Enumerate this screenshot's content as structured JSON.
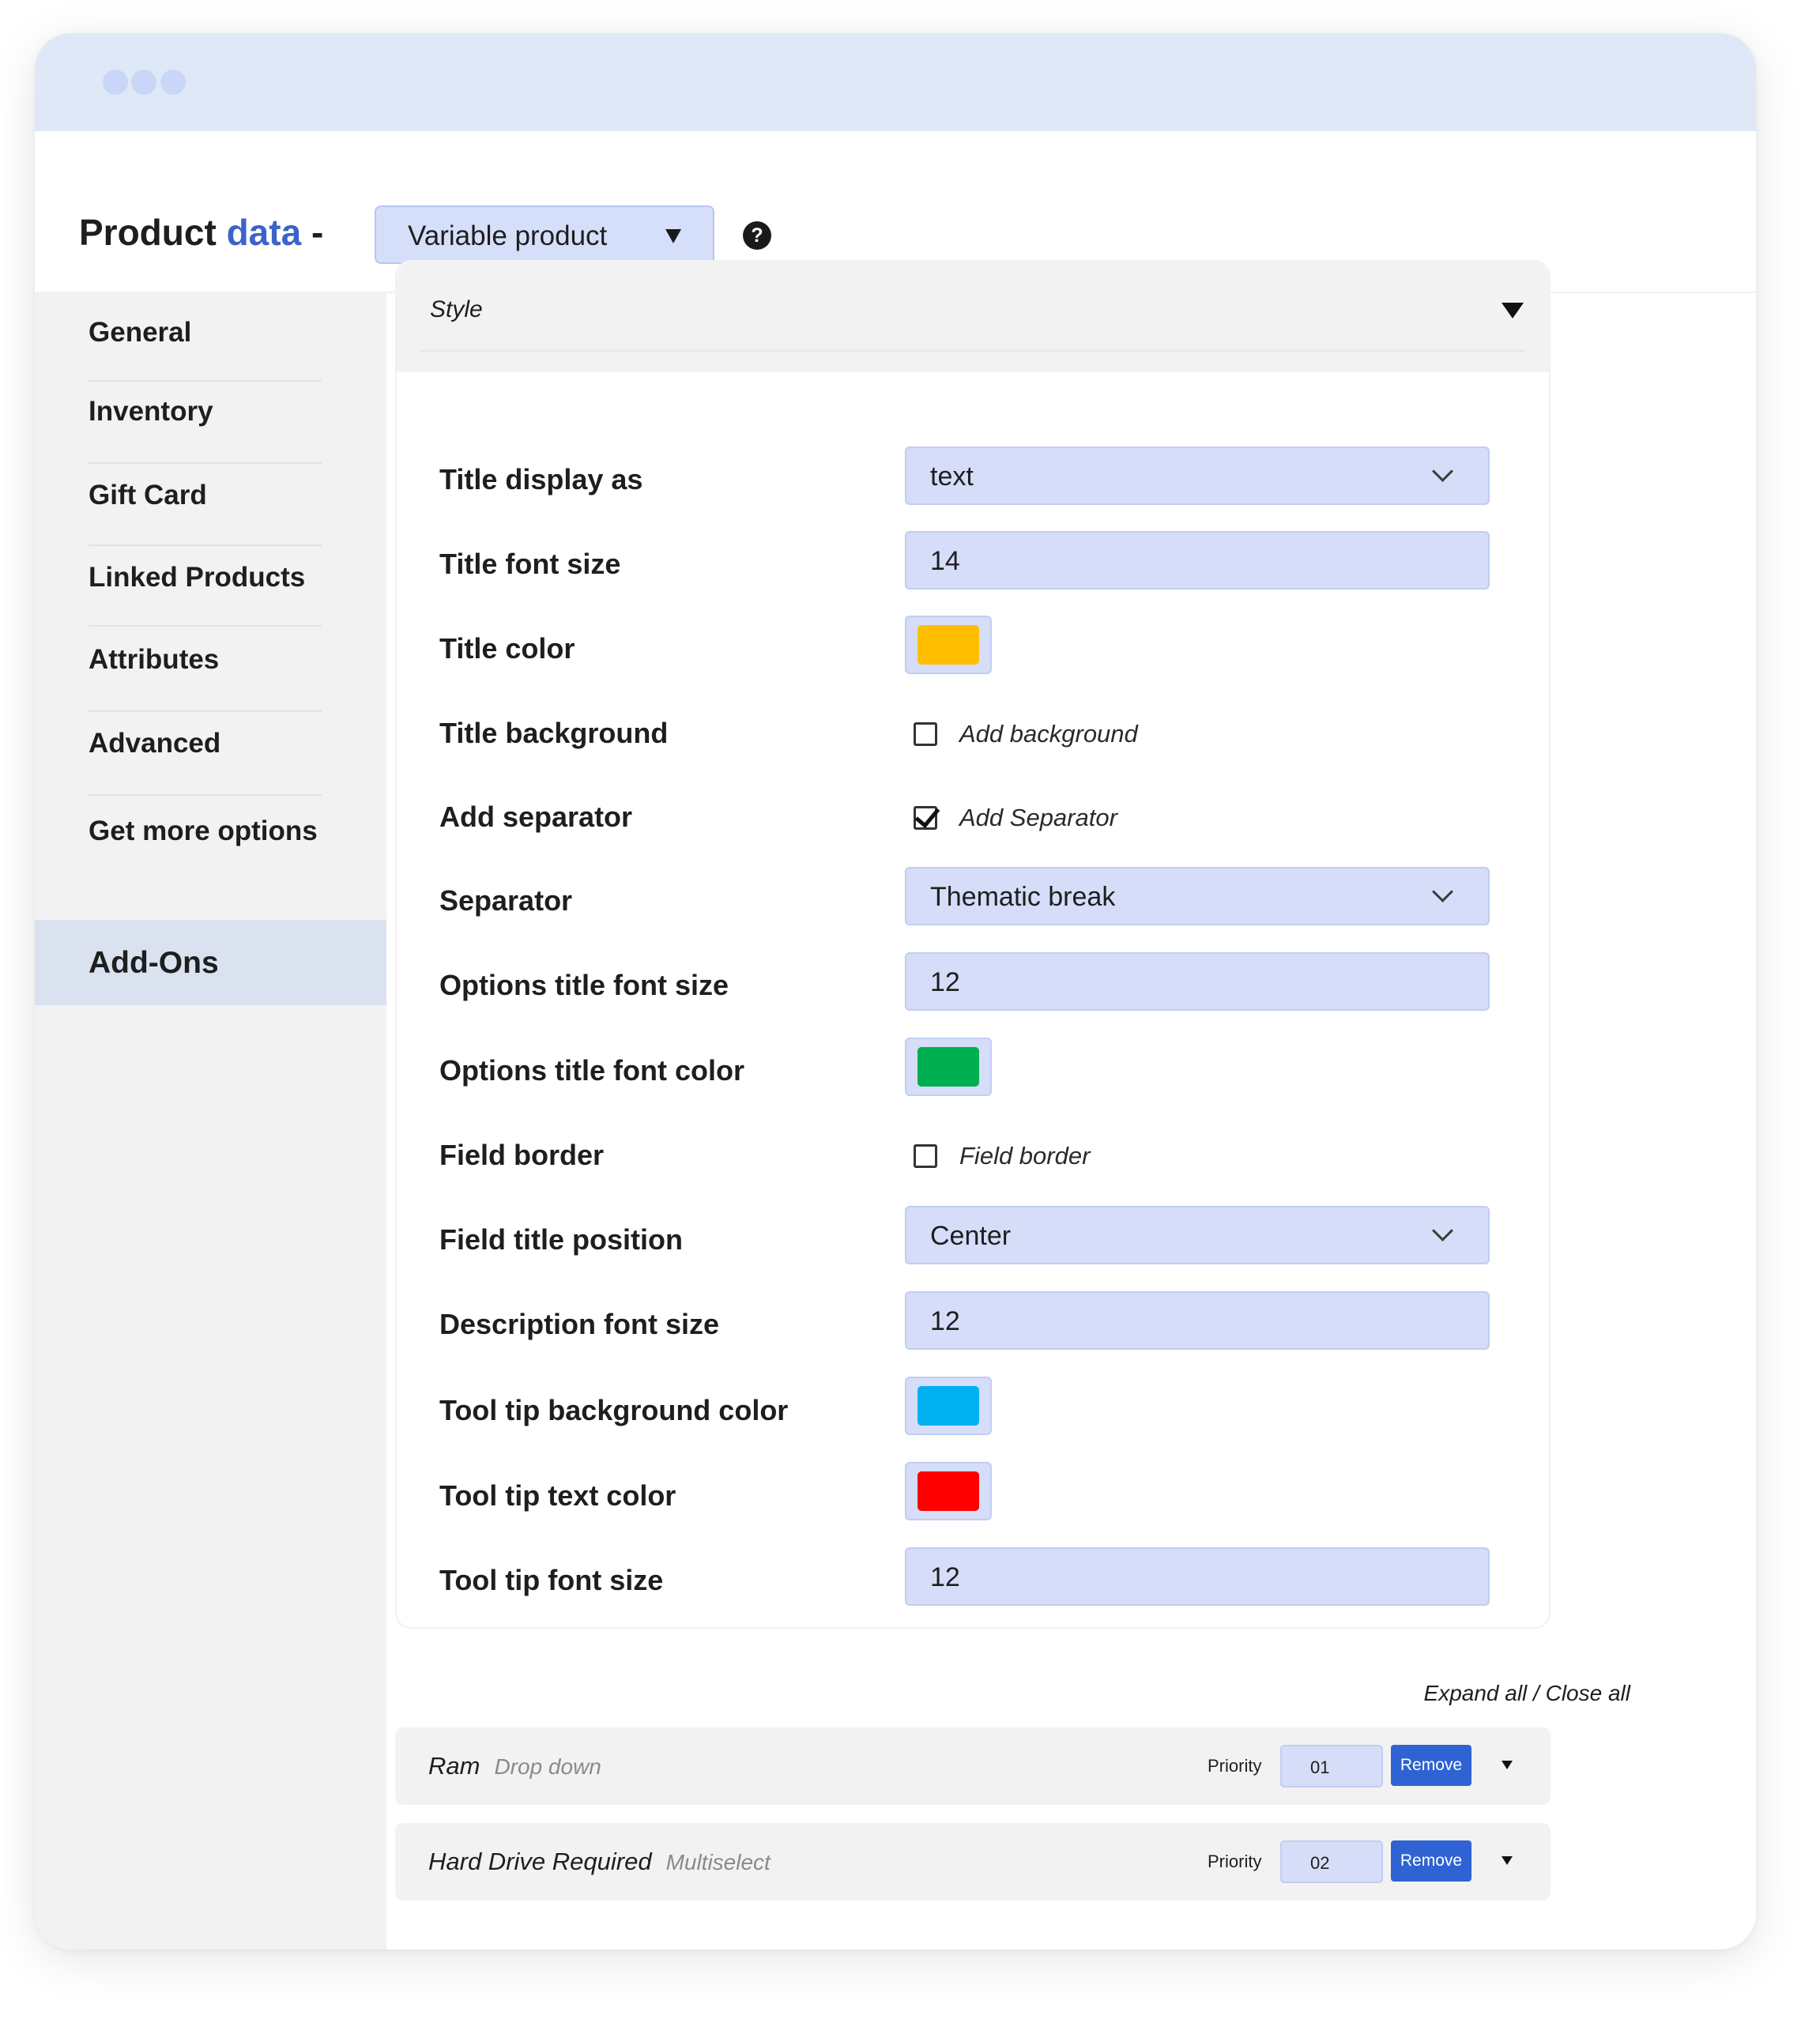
{
  "header": {
    "title_prefix": "Product",
    "title_accent": "data",
    "title_suffix": "-",
    "product_type": "Variable product",
    "help_glyph": "?"
  },
  "sidebar": {
    "items": [
      {
        "label": "General"
      },
      {
        "label": "Inventory"
      },
      {
        "label": "Gift Card"
      },
      {
        "label": "Linked Products"
      },
      {
        "label": "Attributes"
      },
      {
        "label": "Advanced"
      },
      {
        "label": "Get more options"
      }
    ],
    "active_label": "Add-Ons"
  },
  "style_panel": {
    "title": "Style",
    "rows": [
      {
        "label": "Title display as",
        "type": "select",
        "value": "text"
      },
      {
        "label": "Title font size",
        "type": "input",
        "value": "14"
      },
      {
        "label": "Title color",
        "type": "color",
        "color": "#ffbf00"
      },
      {
        "label": "Title background",
        "type": "checkbox",
        "checked": false,
        "text": "Add background"
      },
      {
        "label": "Add separator",
        "type": "checkbox",
        "checked": true,
        "text": "Add Separator"
      },
      {
        "label": "Separator",
        "type": "select",
        "value": "Thematic break"
      },
      {
        "label": "Options title font size",
        "type": "input",
        "value": "12"
      },
      {
        "label": "Options title font color",
        "type": "color",
        "color": "#00b050"
      },
      {
        "label": "Field border",
        "type": "checkbox",
        "checked": false,
        "text": "Field border"
      },
      {
        "label": "Field title position",
        "type": "select",
        "value": "Center"
      },
      {
        "label": "Description font size",
        "type": "input",
        "value": "12"
      },
      {
        "label": "Tool tip background color",
        "type": "color",
        "color": "#00b0f0"
      },
      {
        "label": "Tool tip text color",
        "type": "color",
        "color": "#ff0000"
      },
      {
        "label": "Tool tip font size",
        "type": "input",
        "value": "12"
      }
    ]
  },
  "expand_close": "Expand all / Close all",
  "addons": [
    {
      "name": "Ram",
      "type": "Drop down",
      "priority_label": "Priority",
      "priority": "01",
      "remove_label": "Remove"
    },
    {
      "name": "Hard Drive Required",
      "type": "Multiselect",
      "priority_label": "Priority",
      "priority": "02",
      "remove_label": "Remove"
    }
  ],
  "colors": {
    "accent": "#3b63c8",
    "button": "#2f63d3",
    "field_bg": "#d5ddf8",
    "titlebar": "#dfe8f6"
  }
}
